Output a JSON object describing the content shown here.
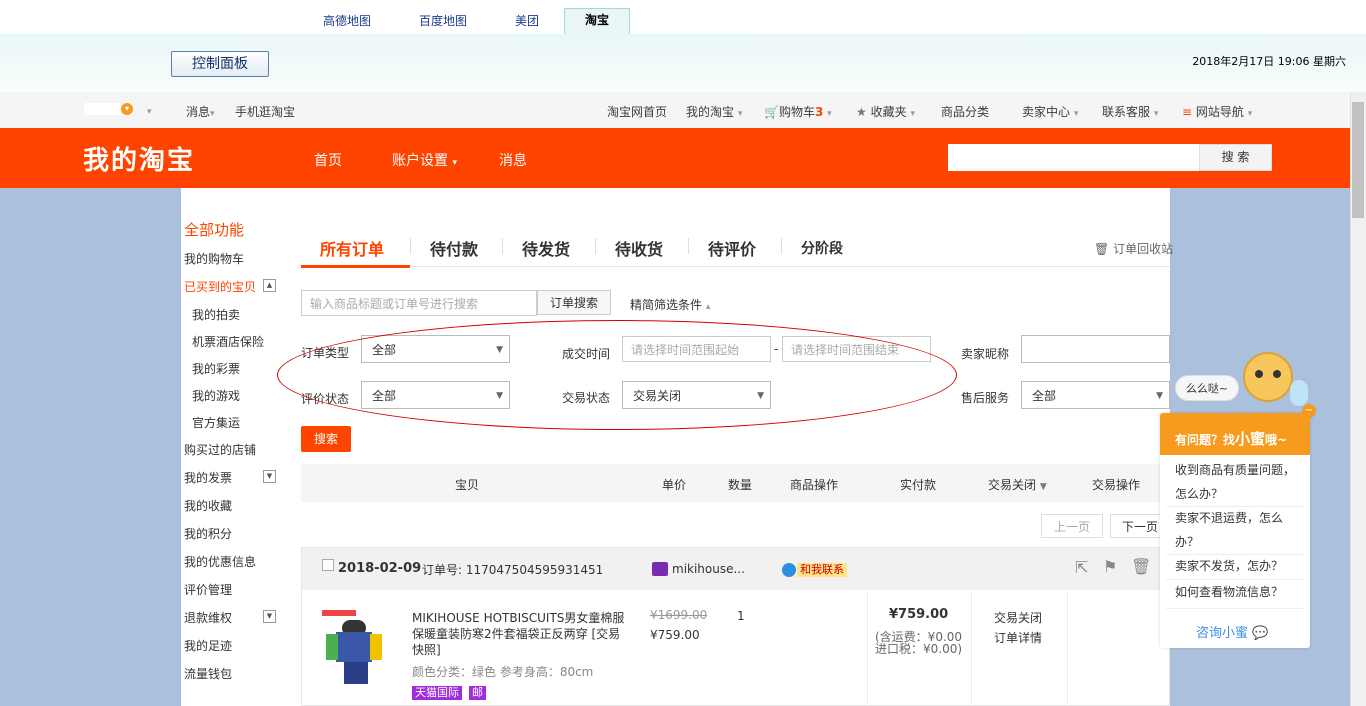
{
  "app_tabs": [
    "高德地图",
    "百度地图",
    "美团",
    "淘宝"
  ],
  "control_panel_label": "控制面板",
  "datetime": "2018年2月17日  19:06  星期六",
  "site_nav": {
    "messages": "消息",
    "mobile": "手机逛淘宝",
    "home": "淘宝网首页",
    "my_taobao": "我的淘宝",
    "cart": "购物车",
    "cart_count": "3",
    "favorites": "收藏夹",
    "categories": "商品分类",
    "seller_center": "卖家中心",
    "contact": "联系客服",
    "site_map": "网站导航"
  },
  "header": {
    "logo": "我的淘宝",
    "nav": [
      "首页",
      "账户设置",
      "消息"
    ],
    "search_button": "搜 索"
  },
  "sidebar": {
    "all_functions": "全部功能",
    "items": [
      "我的购物车",
      "已买到的宝贝",
      "我的拍卖",
      "机票酒店保险",
      "我的彩票",
      "我的游戏",
      "官方集运",
      "购买过的店铺",
      "我的发票",
      "我的收藏",
      "我的积分",
      "我的优惠信息",
      "评价管理",
      "退款维权",
      "我的足迹",
      "流量钱包"
    ]
  },
  "order_tabs": [
    "所有订单",
    "待付款",
    "待发货",
    "待收货",
    "待评价",
    "分阶段"
  ],
  "recycle_bin": "订单回收站",
  "filter": {
    "search_placeholder": "输入商品标题或订单号进行搜索",
    "order_search_button": "订单搜索",
    "advanced_toggle": "精简筛选条件",
    "order_type_label": "订单类型",
    "order_type_value": "全部",
    "deal_time_label": "成交时间",
    "time_start_placeholder": "请选择时间范围起始",
    "time_dash": "-",
    "time_end_placeholder": "请选择时间范围结束",
    "seller_nick_label": "卖家昵称",
    "review_status_label": "评价状态",
    "review_status_value": "全部",
    "trade_status_label": "交易状态",
    "trade_status_value": "交易关闭",
    "after_sale_label": "售后服务",
    "after_sale_value": "全部",
    "search_button": "搜索"
  },
  "table_header": [
    "宝贝",
    "单价",
    "数量",
    "商品操作",
    "实付款",
    "交易关闭",
    "交易操作"
  ],
  "pagination": {
    "prev": "上一页",
    "next": "下一页"
  },
  "order": {
    "date": "2018-02-09",
    "order_no_label": "订单号:",
    "order_no": "117047504595931451",
    "shop": "mikihouse...",
    "contact": "和我联系",
    "title": "MIKIHOUSE HOTBISCUITS男女童棉服保暖童装防寒2件套福袋正反两穿 [交易快照]",
    "attrs": "颜色分类：绿色   参考身高：80cm",
    "badge_tmall": "天猫国际",
    "badge_post": "邮",
    "original_price": "¥1699.00",
    "price": "¥759.00",
    "quantity": "1",
    "paid": "¥759.00",
    "shipping": "(含运费：¥0.00",
    "import_tax": "进口税：¥0.00)",
    "status": "交易关闭",
    "detail": "订单详情"
  },
  "helper": {
    "bubble": "么么哒~",
    "title_prefix": "有问题？找",
    "title_name": "小蜜",
    "title_suffix": "哦~",
    "questions": [
      "收到商品有质量问题，怎么办？",
      "卖家不退运费，怎么办？",
      "卖家不发货，怎办？",
      "如何查看物流信息？"
    ],
    "consult": "咨询小蜜"
  }
}
